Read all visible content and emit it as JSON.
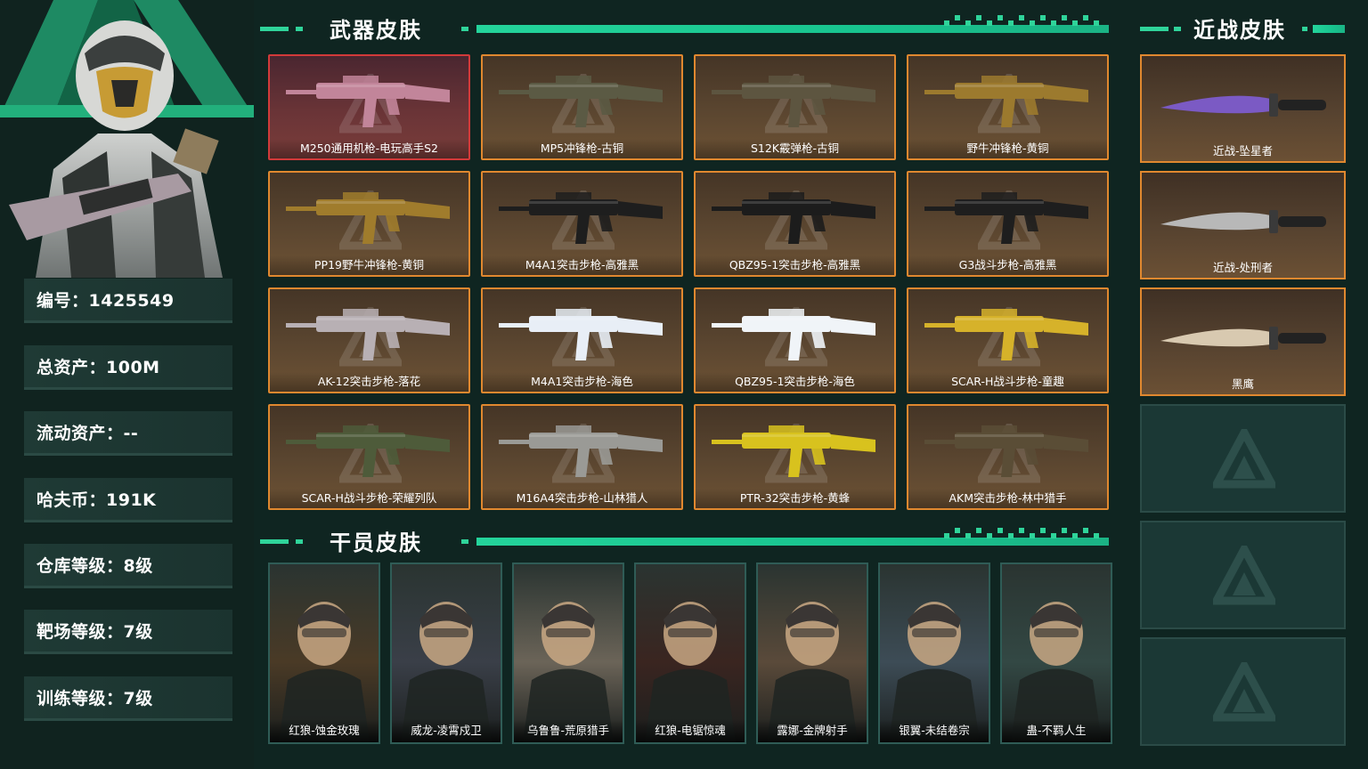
{
  "sections": {
    "weapon_title": "武器皮肤",
    "operator_title": "干员皮肤",
    "melee_title": "近战皮肤"
  },
  "profile": {
    "rows": [
      {
        "label": "编号：1425549"
      },
      {
        "label": "总资产：100M"
      },
      {
        "label": "流动资产：--"
      },
      {
        "label": "哈夫币：191K"
      },
      {
        "label": "仓库等级：8级"
      },
      {
        "label": "靶场等级：7级"
      },
      {
        "label": "训练等级：7级"
      }
    ]
  },
  "weapons": [
    {
      "name": "M250通用机枪-电玩高手S2",
      "rarity": "red",
      "color": "#c2859a"
    },
    {
      "name": "MP5冲锋枪-古铜",
      "rarity": "orange",
      "color": "#5b5a44"
    },
    {
      "name": "S12K霰弹枪-古铜",
      "rarity": "orange",
      "color": "#5d5540"
    },
    {
      "name": "野牛冲锋枪-黄铜",
      "rarity": "orange",
      "color": "#9c7a2e"
    },
    {
      "name": "PP19野牛冲锋枪-黄铜",
      "rarity": "orange",
      "color": "#a07c2c"
    },
    {
      "name": "M4A1突击步枪-高雅黑",
      "rarity": "orange",
      "color": "#1e1e1e"
    },
    {
      "name": "QBZ95-1突击步枪-高雅黑",
      "rarity": "orange",
      "color": "#1c1c1c"
    },
    {
      "name": "G3战斗步枪-高雅黑",
      "rarity": "orange",
      "color": "#1e1e1e"
    },
    {
      "name": "AK-12突击步枪-落花",
      "rarity": "orange",
      "color": "#b8b0b4"
    },
    {
      "name": "M4A1突击步枪-海色",
      "rarity": "orange",
      "color": "#e8eef6"
    },
    {
      "name": "QBZ95-1突击步枪-海色",
      "rarity": "orange",
      "color": "#f0f4f8"
    },
    {
      "name": "SCAR-H战斗步枪-童趣",
      "rarity": "orange",
      "color": "#d6b22a"
    },
    {
      "name": "SCAR-H战斗步枪-荣耀列队",
      "rarity": "orange",
      "color": "#4e5b3a"
    },
    {
      "name": "M16A4突击步枪-山林猎人",
      "rarity": "orange",
      "color": "#9a9a96"
    },
    {
      "name": "PTR-32突击步枪-黄蜂",
      "rarity": "orange",
      "color": "#d8c21e"
    },
    {
      "name": "AKM突击步枪-林中猎手",
      "rarity": "orange",
      "color": "#5a4d36"
    }
  ],
  "operators": [
    {
      "name": "红狼-蚀金玫瑰",
      "color": "#4a3a26"
    },
    {
      "name": "威龙-凌霄戍卫",
      "color": "#3a3f48"
    },
    {
      "name": "乌鲁鲁-荒原猎手",
      "color": "#6b6458"
    },
    {
      "name": "红狼-电锯惊魂",
      "color": "#3a2520"
    },
    {
      "name": "露娜-金牌射手",
      "color": "#5a4a3a"
    },
    {
      "name": "银翼-未结卷宗",
      "color": "#3d4c56"
    },
    {
      "name": "蛊-不羁人生",
      "color": "#334844"
    }
  ],
  "melee": [
    {
      "name": "近战-坠星者",
      "color": "#7b5ac4"
    },
    {
      "name": "近战-处刑者",
      "color": "#b8b8b8"
    },
    {
      "name": "黑鹰",
      "color": "#d8c9b0"
    }
  ],
  "melee_empty_slots": 3,
  "colors": {
    "accent": "#2fd49a",
    "background": "#0f2521",
    "orange_border": "#e0882f",
    "red_border": "#d23a3a"
  }
}
